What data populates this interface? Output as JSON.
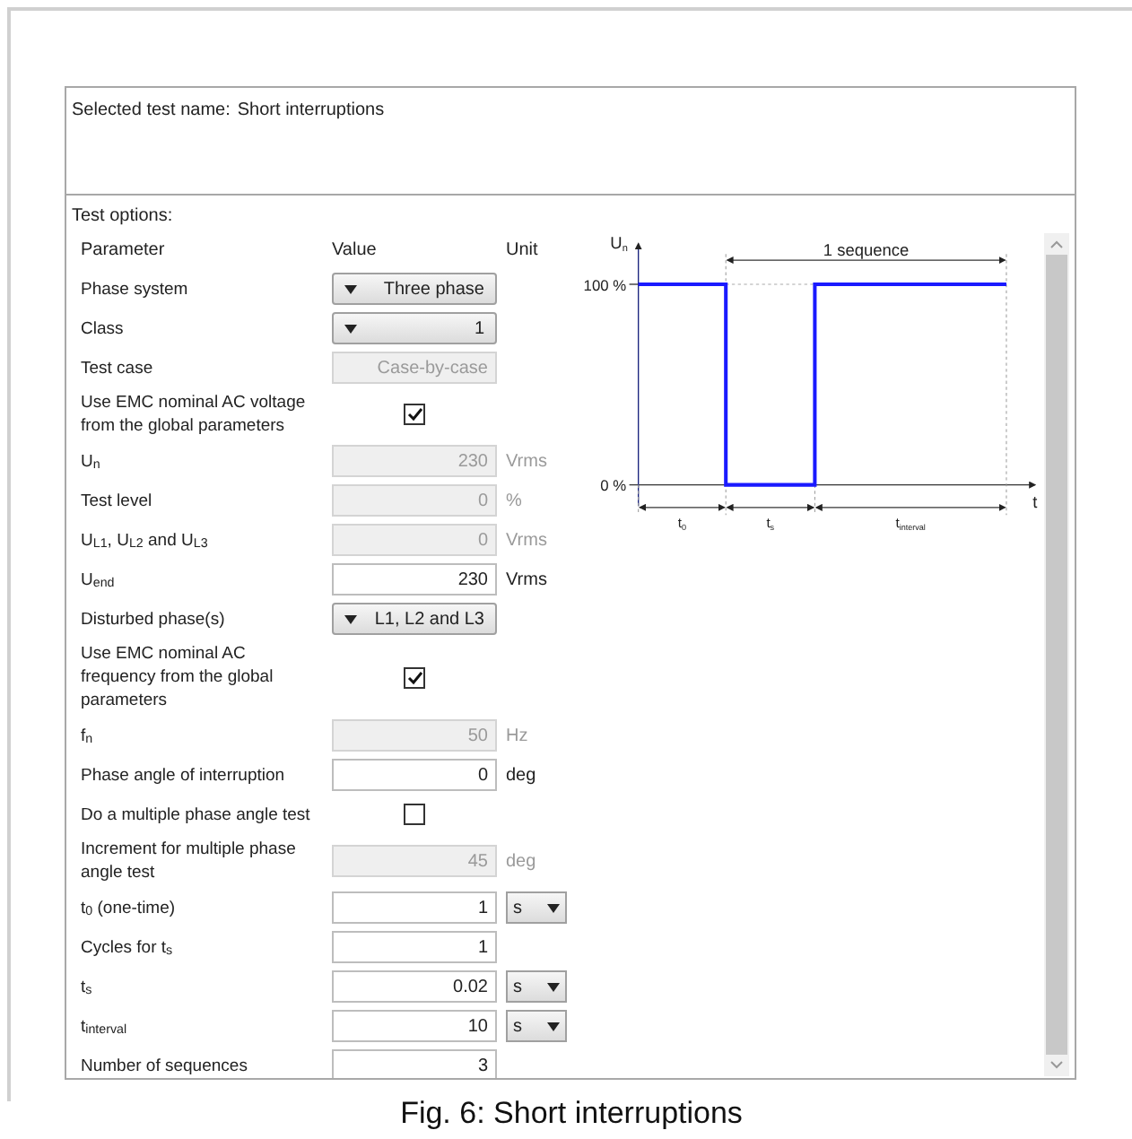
{
  "header": {
    "label": "Selected test name:",
    "value": "Short interruptions"
  },
  "section_title": "Test options:",
  "columns": [
    "Parameter",
    "Value",
    "Unit"
  ],
  "rows": [
    {
      "kind": "dropdown",
      "label": "Phase system",
      "value": "Three phase"
    },
    {
      "kind": "dropdown",
      "label": "Class",
      "value": "1"
    },
    {
      "kind": "field",
      "label": "Test case",
      "value": "Case-by-case",
      "disabled": true
    },
    {
      "kind": "checkbox",
      "label": "Use EMC nominal AC voltage from the global parameters",
      "checked": true
    },
    {
      "kind": "field",
      "label": "U$_{n}$",
      "value": "230",
      "unit": "Vrms",
      "disabled": true
    },
    {
      "kind": "field",
      "label": "Test level",
      "value": "0",
      "unit": "%",
      "disabled": true
    },
    {
      "kind": "field",
      "label": "U$_{L1}$, U$_{L2}$ and U$_{L3}$",
      "value": "0",
      "unit": "Vrms",
      "disabled": true
    },
    {
      "kind": "field",
      "label": "U$_{end}$",
      "value": "230",
      "unit": "Vrms",
      "disabled": false
    },
    {
      "kind": "dropdown",
      "label": "Disturbed phase(s)",
      "value": "L1, L2 and L3"
    },
    {
      "kind": "checkbox",
      "label": "Use EMC nominal AC frequency from the global parameters",
      "checked": true
    },
    {
      "kind": "field",
      "label": "f$_{n}$",
      "value": "50",
      "unit": "Hz",
      "disabled": true
    },
    {
      "kind": "field",
      "label": "Phase angle of interruption",
      "value": "0",
      "unit": "deg",
      "disabled": false
    },
    {
      "kind": "checkbox",
      "label": "Do a multiple phase angle test",
      "checked": false
    },
    {
      "kind": "field",
      "label": "Increment for multiple phase angle test",
      "value": "45",
      "unit": "deg",
      "disabled": true
    },
    {
      "kind": "field_unit_select",
      "label": "t$_{0}$ (one-time)",
      "value": "1",
      "unit": "s",
      "disabled": false
    },
    {
      "kind": "field",
      "label": "Cycles for t$_{s}$",
      "value": "1",
      "disabled": false
    },
    {
      "kind": "field_unit_select",
      "label": "t$_{s}$",
      "value": "0.02",
      "unit": "s",
      "disabled": false
    },
    {
      "kind": "field_unit_select",
      "label": "t$_{interval}$",
      "value": "10",
      "unit": "s",
      "disabled": false
    },
    {
      "kind": "field",
      "label": "Number of sequences",
      "value": "3",
      "disabled": false
    }
  ],
  "diagram": {
    "y_axis": {
      "text": "U",
      "sub": "n"
    },
    "x_axis": {
      "text": "t"
    },
    "high_label": "100 %",
    "low_label": "0 %",
    "sequence_label": "1 sequence",
    "spans": [
      {
        "text": "t",
        "sub": "0"
      },
      {
        "text": "t",
        "sub": "s"
      },
      {
        "text": "t",
        "sub": "interval"
      }
    ]
  },
  "caption": "Fig. 6: Short interruptions"
}
